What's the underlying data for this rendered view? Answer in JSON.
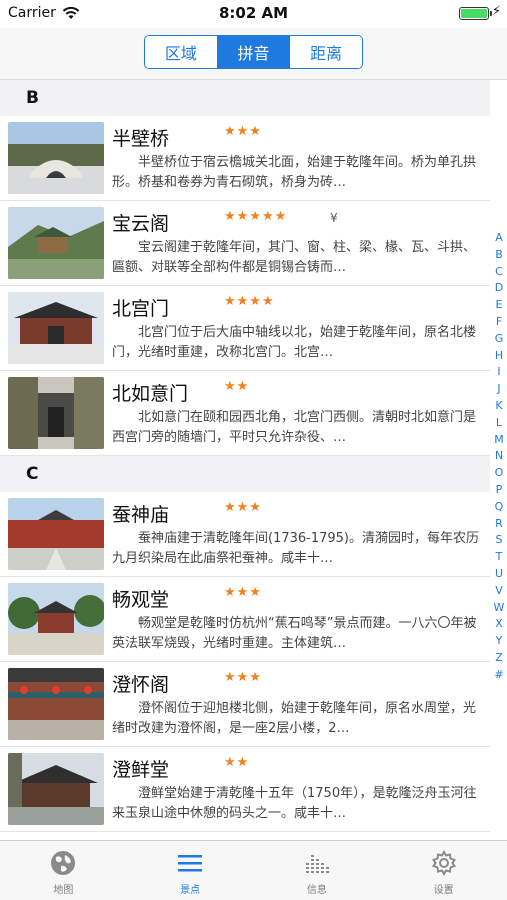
{
  "status": {
    "carrier": "Carrier",
    "time": "8:02 AM",
    "battery_percent": 100
  },
  "segments": [
    {
      "label": "区域",
      "active": false
    },
    {
      "label": "拼音",
      "active": true
    },
    {
      "label": "距离",
      "active": false
    }
  ],
  "sections": [
    {
      "letter": "B",
      "items": [
        {
          "name": "半壁桥",
          "stars": "★★★",
          "price": "",
          "desc": "半壁桥位于宿云檐城关北面，始建于乾隆年间。桥为单孔拱形。桥基和卷券为青石砌筑，桥身为砖…"
        },
        {
          "name": "宝云阁",
          "stars": "★★★★★",
          "price": "¥",
          "desc": "宝云阁建于乾隆年间，其门、窗、柱、梁、椽、瓦、斗拱、匾额、对联等全部构件都是铜锡合铸而…"
        },
        {
          "name": "北宫门",
          "stars": "★★★★",
          "price": "",
          "desc": "北宫门位于后大庙中轴线以北，始建于乾隆年间，原名北楼门，光绪时重建，改称北宫门。北宫…"
        },
        {
          "name": "北如意门",
          "stars": "★★",
          "price": "",
          "desc": "北如意门在颐和园西北角，北宫门西侧。清朝时北如意门是西宫门旁的随墙门，平时只允许杂役、…"
        }
      ]
    },
    {
      "letter": "C",
      "items": [
        {
          "name": "蚕神庙",
          "stars": "★★★",
          "price": "",
          "desc": "蚕神庙建于清乾隆年间(1736-1795)。清漪园时，每年农历九月织染局在此庙祭祀蚕神。咸丰十…"
        },
        {
          "name": "畅观堂",
          "stars": "★★★",
          "price": "",
          "desc": "畅观堂是乾隆时仿杭州“蕉石鸣琴”景点而建。一八六〇年被英法联军烧毁，光绪时重建。主体建筑…"
        },
        {
          "name": "澄怀阁",
          "stars": "★★★",
          "price": "",
          "desc": "澄怀阁位于迎旭楼北侧，始建于乾隆年间，原名水周堂，光绪时改建为澄怀阁，是一座2层小楼，2…"
        },
        {
          "name": "澄鲜堂",
          "stars": "★★",
          "price": "",
          "desc": "澄鲜堂始建于清乾隆十五年（1750年），是乾隆泛舟玉河往来玉泉山途中休憩的码头之一。咸丰十…"
        }
      ]
    }
  ],
  "index_letters": [
    "A",
    "B",
    "C",
    "D",
    "E",
    "F",
    "G",
    "H",
    "I",
    "J",
    "K",
    "L",
    "M",
    "N",
    "O",
    "P",
    "Q",
    "R",
    "S",
    "T",
    "U",
    "V",
    "W",
    "X",
    "Y",
    "Z",
    "#"
  ],
  "tabs": [
    {
      "label": "地图",
      "icon": "globe-icon",
      "active": false
    },
    {
      "label": "景点",
      "icon": "list-icon",
      "active": true
    },
    {
      "label": "信息",
      "icon": "equalizer-icon",
      "active": false
    },
    {
      "label": "设置",
      "icon": "gear-icon",
      "active": false
    }
  ],
  "colors": {
    "accent": "#1f7ae0",
    "stars": "#f5801e",
    "section_bg": "#f2f2f4"
  }
}
